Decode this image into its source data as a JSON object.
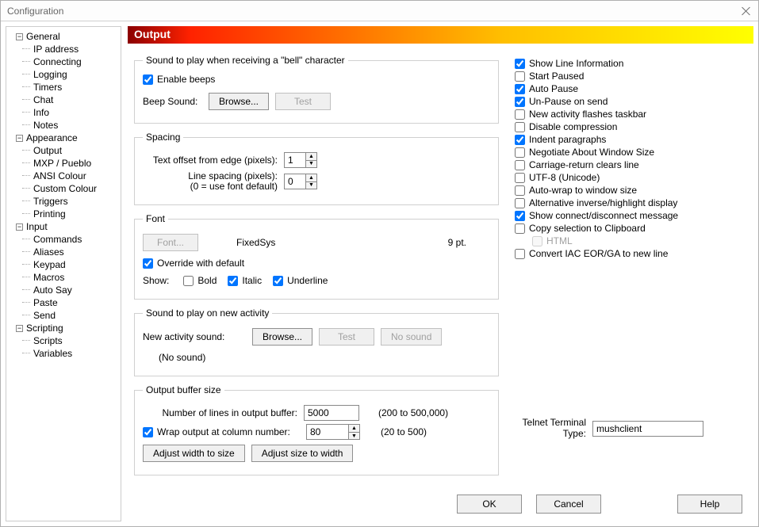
{
  "window_title": "Configuration",
  "tree": {
    "general": {
      "label": "General",
      "expanded": true,
      "items": [
        "IP address",
        "Connecting",
        "Logging",
        "Timers",
        "Chat",
        "Info",
        "Notes"
      ]
    },
    "appearance": {
      "label": "Appearance",
      "expanded": true,
      "items": [
        "Output",
        "MXP / Pueblo",
        "ANSI Colour",
        "Custom Colour",
        "Triggers",
        "Printing"
      ]
    },
    "input": {
      "label": "Input",
      "expanded": true,
      "items": [
        "Commands",
        "Aliases",
        "Keypad",
        "Macros",
        "Auto Say",
        "Paste",
        "Send"
      ]
    },
    "scripting": {
      "label": "Scripting",
      "expanded": true,
      "items": [
        "Scripts",
        "Variables"
      ]
    }
  },
  "panel_title": "Output",
  "bell": {
    "legend": "Sound to play when receiving a \"bell\" character",
    "enable_label": "Enable beeps",
    "enable_checked": true,
    "beep_sound_label": "Beep Sound:",
    "browse_label": "Browse...",
    "test_label": "Test"
  },
  "spacing": {
    "legend": "Spacing",
    "offset_label": "Text offset from edge (pixels):",
    "offset_value": "1",
    "linespacing_label": "Line spacing (pixels):",
    "linespacing_hint": "(0 = use font default)",
    "linespacing_value": "0"
  },
  "font": {
    "legend": "Font",
    "button_label": "Font...",
    "name": "FixedSys",
    "size": "9 pt.",
    "override_label": "Override with default",
    "override_checked": true,
    "show_label": "Show:",
    "bold_label": "Bold",
    "bold_checked": false,
    "italic_label": "Italic",
    "italic_checked": true,
    "underline_label": "Underline",
    "underline_checked": true
  },
  "newactivity": {
    "legend": "Sound to play on new activity",
    "label": "New activity sound:",
    "browse_label": "Browse...",
    "test_label": "Test",
    "nosound_btn": "No sound",
    "current": "(No sound)"
  },
  "buffer": {
    "legend": "Output buffer size",
    "lines_label": "Number of lines in output buffer:",
    "lines_value": "5000",
    "lines_range": "(200 to 500,000)",
    "wrap_label": "Wrap output at column number:",
    "wrap_checked": true,
    "wrap_value": "80",
    "wrap_range": "(20 to 500)",
    "adjust_w2s": "Adjust width to size",
    "adjust_s2w": "Adjust size to width"
  },
  "options": [
    {
      "label": "Show Line Information",
      "checked": true
    },
    {
      "label": "Start Paused",
      "checked": false
    },
    {
      "label": "Auto Pause",
      "checked": true
    },
    {
      "label": "Un-Pause on send",
      "checked": true
    },
    {
      "label": "New activity flashes taskbar",
      "checked": false
    },
    {
      "label": "Disable compression",
      "checked": false
    },
    {
      "label": "Indent paragraphs",
      "checked": true
    },
    {
      "label": "Negotiate About Window Size",
      "checked": false
    },
    {
      "label": "Carriage-return clears line",
      "checked": false
    },
    {
      "label": "UTF-8 (Unicode)",
      "checked": false
    },
    {
      "label": "Auto-wrap to window size",
      "checked": false
    },
    {
      "label": "Alternative inverse/highlight display",
      "checked": false
    },
    {
      "label": "Show connect/disconnect message",
      "checked": true
    },
    {
      "label": "Copy selection to Clipboard",
      "checked": false
    }
  ],
  "option_html": {
    "label": "HTML",
    "checked": false
  },
  "option_eor": {
    "label": "Convert IAC EOR/GA to new line",
    "checked": false
  },
  "telnet": {
    "label": "Telnet Terminal Type:",
    "value": "mushclient"
  },
  "footer": {
    "ok": "OK",
    "cancel": "Cancel",
    "help": "Help"
  }
}
